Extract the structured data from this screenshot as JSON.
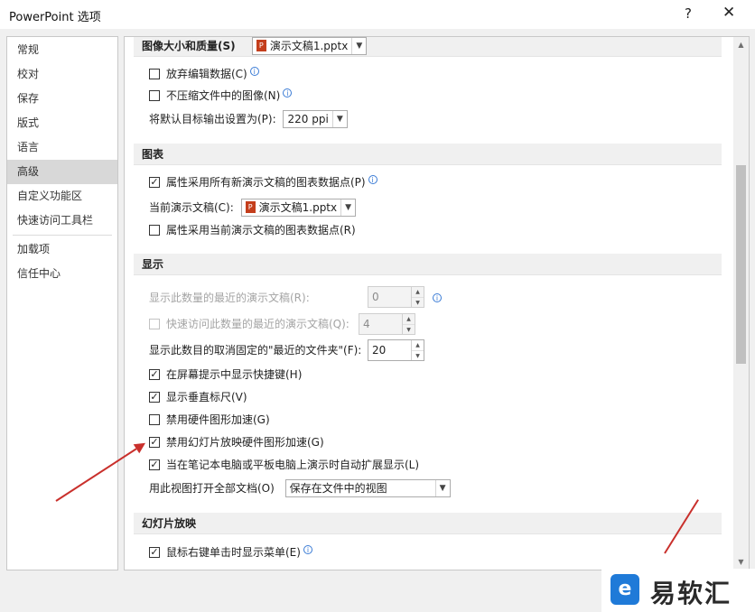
{
  "window": {
    "title": "PowerPoint 选项",
    "help": "?",
    "close": "✕"
  },
  "sidebar": {
    "items": [
      {
        "label": "常规"
      },
      {
        "label": "校对"
      },
      {
        "label": "保存"
      },
      {
        "label": "版式"
      },
      {
        "label": "语言"
      },
      {
        "label": "高级"
      },
      {
        "label": "自定义功能区"
      },
      {
        "label": "快速访问工具栏"
      },
      {
        "label": "加载项"
      },
      {
        "label": "信任中心"
      }
    ],
    "active": "高级"
  },
  "image_quality": {
    "header": "图像大小和质量(S)",
    "doc": "演示文稿1.pptx",
    "discard_edit": {
      "label": "放弃编辑数据(C)",
      "checked": false
    },
    "no_compress": {
      "label": "不压缩文件中的图像(N)",
      "checked": false
    },
    "default_output_label": "将默认目标输出设置为(P):",
    "default_output": "220 ppi"
  },
  "charts": {
    "header": "图表",
    "all_new": {
      "label": "属性采用所有新演示文稿的图表数据点(P)",
      "checked": true
    },
    "current_doc_label": "当前演示文稿(C):",
    "current_doc": "演示文稿1.pptx",
    "current_props": {
      "label": "属性采用当前演示文稿的图表数据点(R)",
      "checked": false
    }
  },
  "display": {
    "header": "显示",
    "recent_count_label": "显示此数量的最近的演示文稿(R):",
    "recent_count": "0",
    "quick_access_label": "快速访问此数量的最近的演示文稿(Q):",
    "quick_access": "4",
    "unpinned_label": "显示此数目的取消固定的\"最近的文件夹\"(F):",
    "unpinned": "20",
    "shortcut_keys": {
      "label": "在屏幕提示中显示快捷键(H)",
      "checked": true
    },
    "vertical_ruler": {
      "label": "显示垂直标尺(V)",
      "checked": true
    },
    "disable_hw_accel": {
      "label": "禁用硬件图形加速(G)",
      "checked": false
    },
    "disable_slideshow_hw": {
      "label": "禁用幻灯片放映硬件图形加速(G)",
      "checked": true
    },
    "auto_extend": {
      "label": "当在笔记本电脑或平板电脑上演示时自动扩展显示(L)",
      "checked": true
    },
    "open_view_label": "用此视图打开全部文档(O)",
    "open_view": "保存在文件中的视图"
  },
  "slideshow": {
    "header": "幻灯片放映",
    "right_click_menu": {
      "label": "鼠标右键单击时显示菜单(E)",
      "checked": true
    }
  },
  "watermark": {
    "icon": "e",
    "text": "易软汇"
  },
  "check_mark": "✓",
  "arrows": {
    "dropdown": "▼",
    "spin_up": "▲",
    "spin_down": "▼",
    "scroll_up": "▲",
    "scroll_down": "▼"
  },
  "colors": {
    "annotation_arrow": "#c9302c",
    "active_nav": "#d8d8d8"
  }
}
